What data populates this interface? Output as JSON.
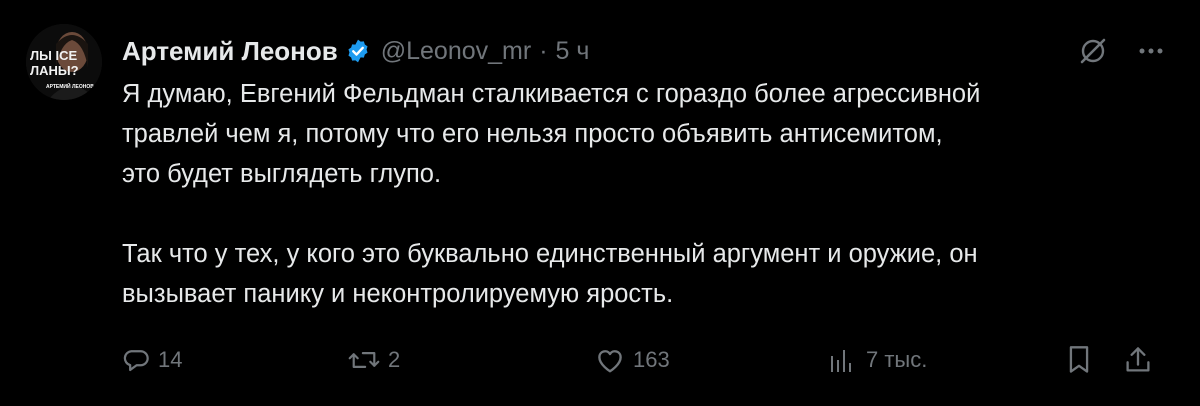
{
  "tweet": {
    "author_name": "Артемий Леонов",
    "handle": "@Leonov_mr",
    "separator": "·",
    "time": "5 ч",
    "avatar_text_line1": "ЛЫ ICE",
    "avatar_text_line2": "ЛАНЫ?",
    "avatar_caption": "АРТЕМИЙ ЛЕОНОВ",
    "text": "Я думаю, Евгений Фельдман сталкивается с гораздо более агрессивной\nтравлей чем я, потому что его нельзя просто объявить антисемитом,\nэто будет выглядеть глупо.\n\nТак что у тех, у кого это буквально единственный аргумент и оружие, он\nвызывает панику и неконтролируемую ярость.",
    "top_icons": [
      "grok-icon",
      "more-icon"
    ]
  },
  "actions": {
    "replies": "14",
    "reposts": "2",
    "likes": "163",
    "views": "7 тыс."
  },
  "colors": {
    "background": "#000000",
    "text": "#e7e9ea",
    "muted": "#71767b",
    "verified": "#1d9bf0"
  }
}
